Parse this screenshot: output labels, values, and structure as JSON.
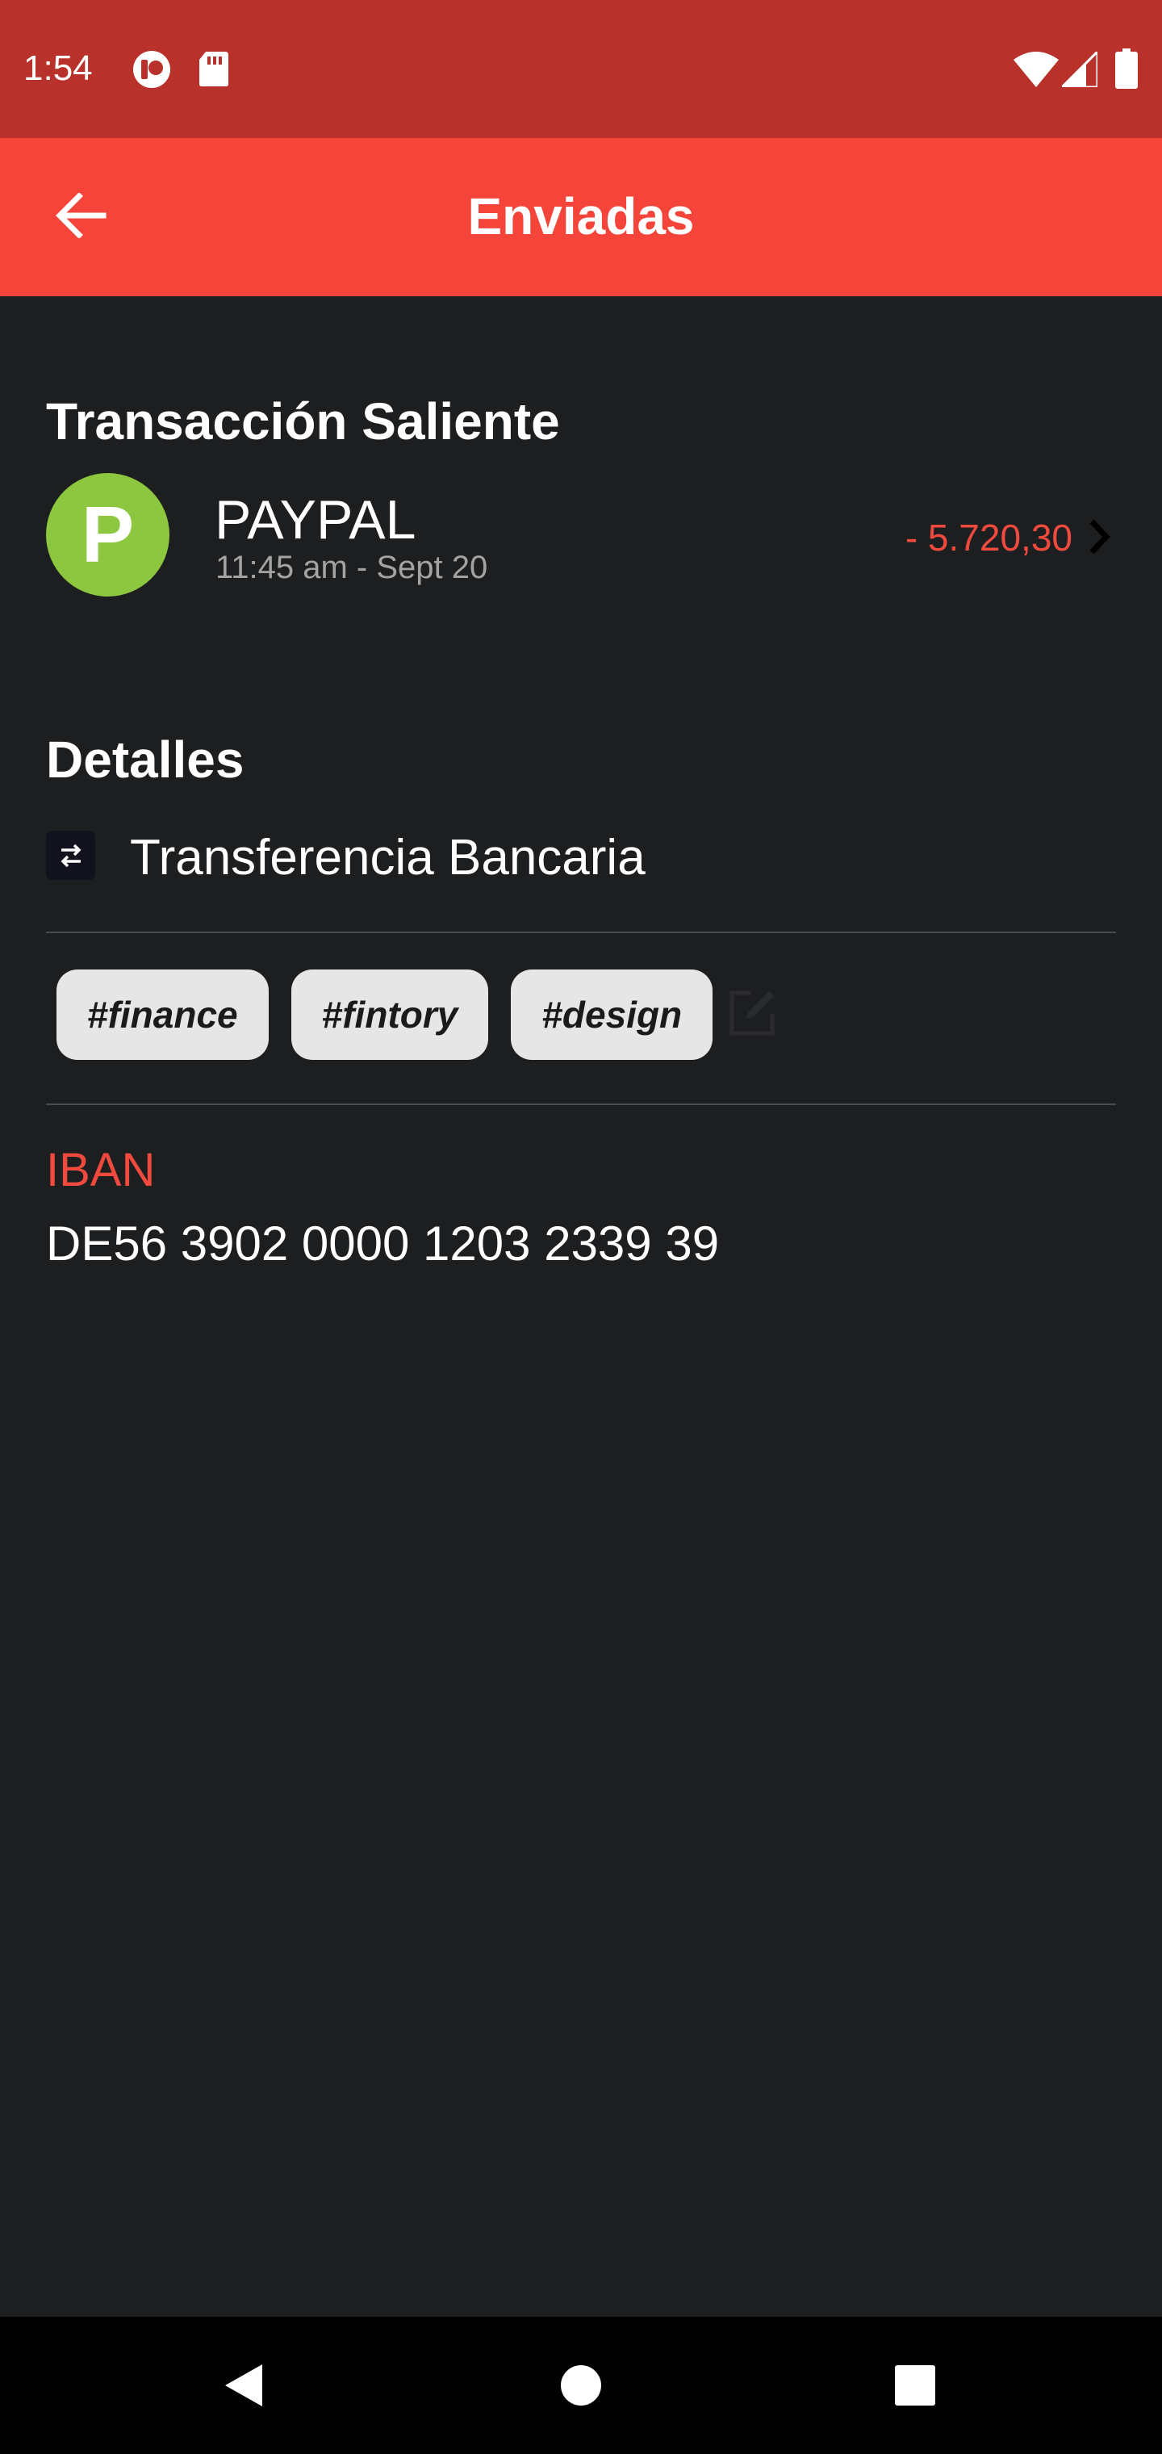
{
  "status_bar": {
    "time": "1:54",
    "icons": [
      "notification-badge-icon",
      "sd-card-icon",
      "wifi-icon",
      "signal-icon",
      "battery-icon"
    ]
  },
  "app_bar": {
    "title": "Enviadas",
    "back_icon": "arrow-back-icon"
  },
  "transaction": {
    "section_title": "Transacción Saliente",
    "avatar_letter": "P",
    "avatar_color": "#8dc63f",
    "merchant": "PAYPAL",
    "datetime": "11:45 am - Sept 20",
    "amount": "- 5.720,30",
    "amount_color": "#f04a3e"
  },
  "details": {
    "section_title": "Detalles",
    "type_icon": "transfer-icon",
    "type_label": "Transferencia Bancaria",
    "tags": [
      "#finance",
      "#fintory",
      "#design"
    ],
    "edit_icon": "edit-icon",
    "iban_label": "IBAN",
    "iban_value": "DE56 3902 0000 1203 2339 39"
  },
  "colors": {
    "status_bar": "#b8322b",
    "app_bar": "#f5443a",
    "background": "#1d1e20",
    "accent_red": "#f04a3e"
  },
  "nav_bar": {
    "buttons": [
      "back-triangle-icon",
      "home-circle-icon",
      "recents-square-icon"
    ]
  }
}
